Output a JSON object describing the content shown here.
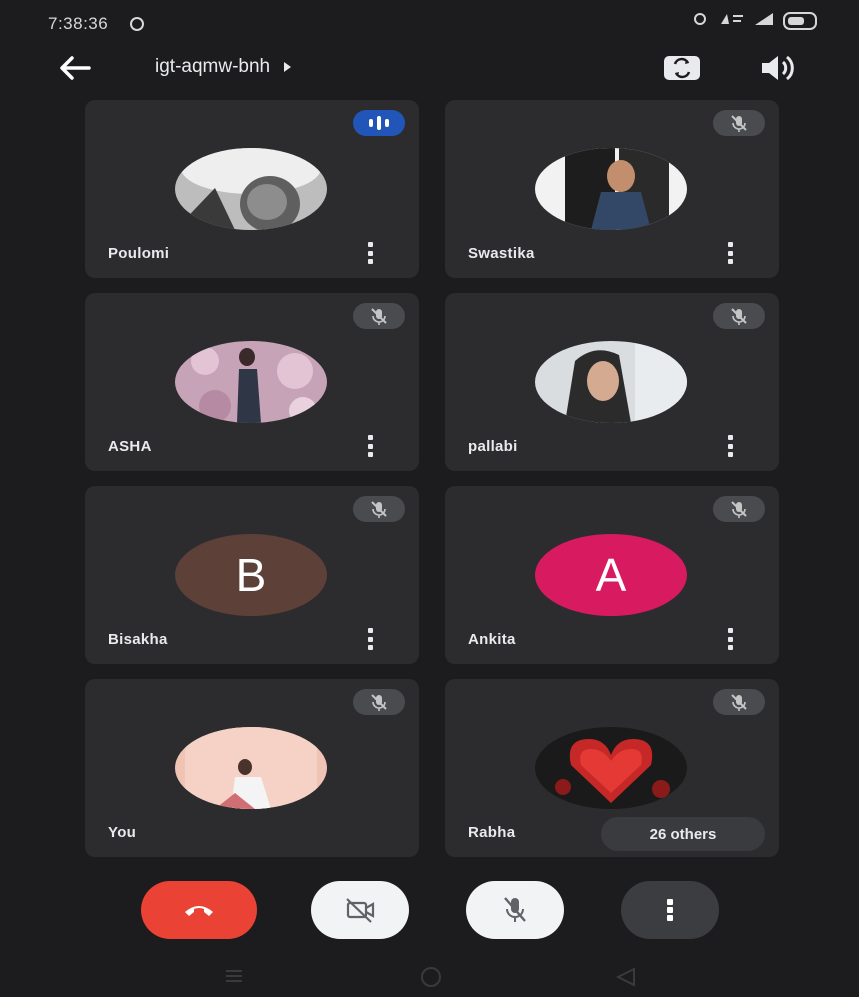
{
  "status_bar": {
    "time": "7:38:36",
    "icons": [
      "alarm-icon",
      "wifi-icon",
      "signal-icon",
      "battery-icon"
    ]
  },
  "app_bar": {
    "meeting_code": "igt-aqmw-bnh",
    "icons": [
      "back-arrow-icon",
      "switch-camera-icon",
      "speaker-icon"
    ]
  },
  "participants": [
    {
      "name": "Poulomi",
      "avatar": "photo",
      "mic": "speaking"
    },
    {
      "name": "Swastika",
      "avatar": "photo",
      "mic": "muted"
    },
    {
      "name": "ASHA",
      "avatar": "photo",
      "mic": "muted"
    },
    {
      "name": "pallabi",
      "avatar": "photo",
      "mic": "muted"
    },
    {
      "name": "Bisakha",
      "avatar_letter": "B",
      "avatar_color": "#5d4037",
      "mic": "muted"
    },
    {
      "name": "Ankita",
      "avatar_letter": "A",
      "avatar_color": "#d81b60",
      "mic": "muted"
    },
    {
      "name": "You",
      "avatar": "photo",
      "mic": "muted"
    },
    {
      "name": "Rabha",
      "avatar": "photo",
      "mic": "muted"
    }
  ],
  "others_chip": "26 others",
  "controls": {
    "end_call_color": "#ea4335",
    "items": [
      "end-call-icon",
      "camera-off-icon",
      "mic-off-icon",
      "more-vert-icon"
    ]
  },
  "nav_bar": [
    "recents-icon",
    "home-icon",
    "back-triangle-icon"
  ]
}
